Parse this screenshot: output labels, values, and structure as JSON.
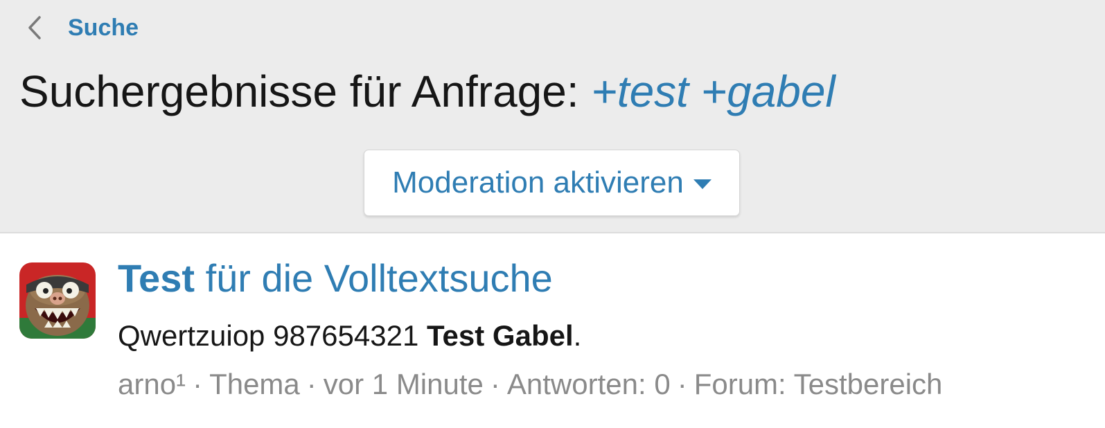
{
  "nav": {
    "back_label": "Suche"
  },
  "header": {
    "title_prefix": "Suchergebnisse für Anfrage:",
    "query": "+test +gabel",
    "moderation_button_label": "Moderation aktivieren"
  },
  "result": {
    "title_highlight": "Test",
    "title_rest": "für die Volltextsuche",
    "snippet_text": "Qwertzuiop 987654321",
    "snippet_highlight": "Test Gabel",
    "snippet_end": ".",
    "meta": {
      "author": "arno¹",
      "type": "Thema",
      "time": "vor 1 Minute",
      "replies": "Antworten: 0",
      "forum_prefix": "Forum:",
      "forum_name": "Testbereich",
      "separator": "·"
    }
  },
  "colors": {
    "accent": "#2f7db3",
    "header_bg": "#ececec",
    "text": "#161616",
    "muted": "#8a8a8a"
  },
  "icons": {
    "back": "chevron-left-icon",
    "dropdown": "caret-down-icon",
    "avatar": "monster-avatar"
  }
}
